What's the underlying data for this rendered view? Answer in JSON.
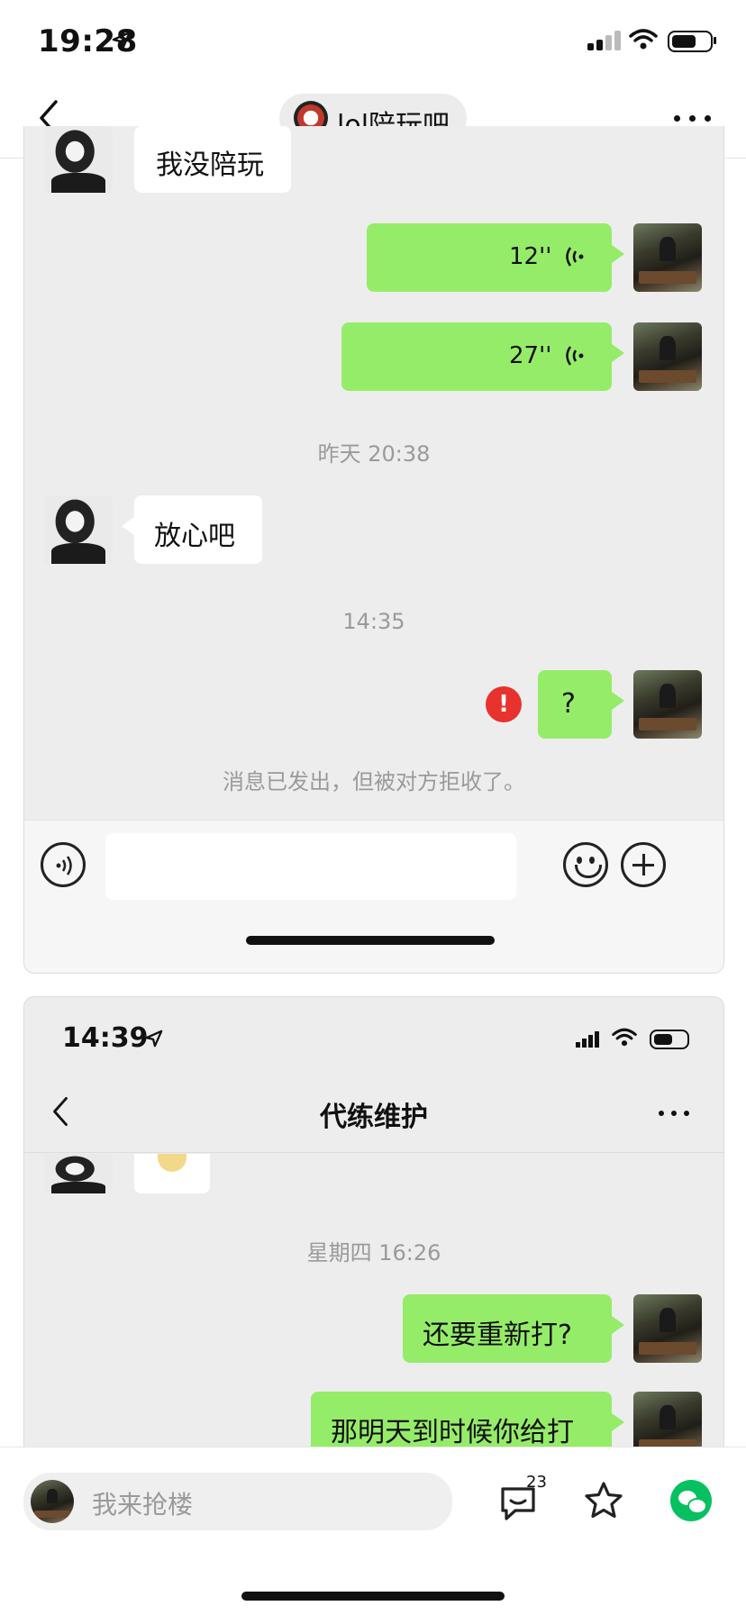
{
  "status_bar": {
    "time": "19:28"
  },
  "header": {
    "title": "lol陪玩吧",
    "group_logo_icon": "group-logo-icon"
  },
  "chat1": {
    "partial_top_text": "我没陪玩",
    "voice1": "12''",
    "voice2": "27''",
    "timestamp1": "昨天 20:38",
    "msg_incoming": "放心吧",
    "timestamp2": "14:35",
    "msg_outgoing": "?",
    "error_mark": "!",
    "rejected_notice": "消息已发出，但被对方拒收了。"
  },
  "inner_screen": {
    "time": "14:39",
    "title": "代练维护",
    "timestamp": "星期四 16:26",
    "msg1": "还要重新打?",
    "msg2": "那明天到时候你给打"
  },
  "bottom_bar": {
    "comment_placeholder": "我来抢楼",
    "comment_count": "23"
  },
  "colors": {
    "bubble_green": "#95ec69",
    "error_red": "#e8322d",
    "wechat_green": "#07c160"
  }
}
